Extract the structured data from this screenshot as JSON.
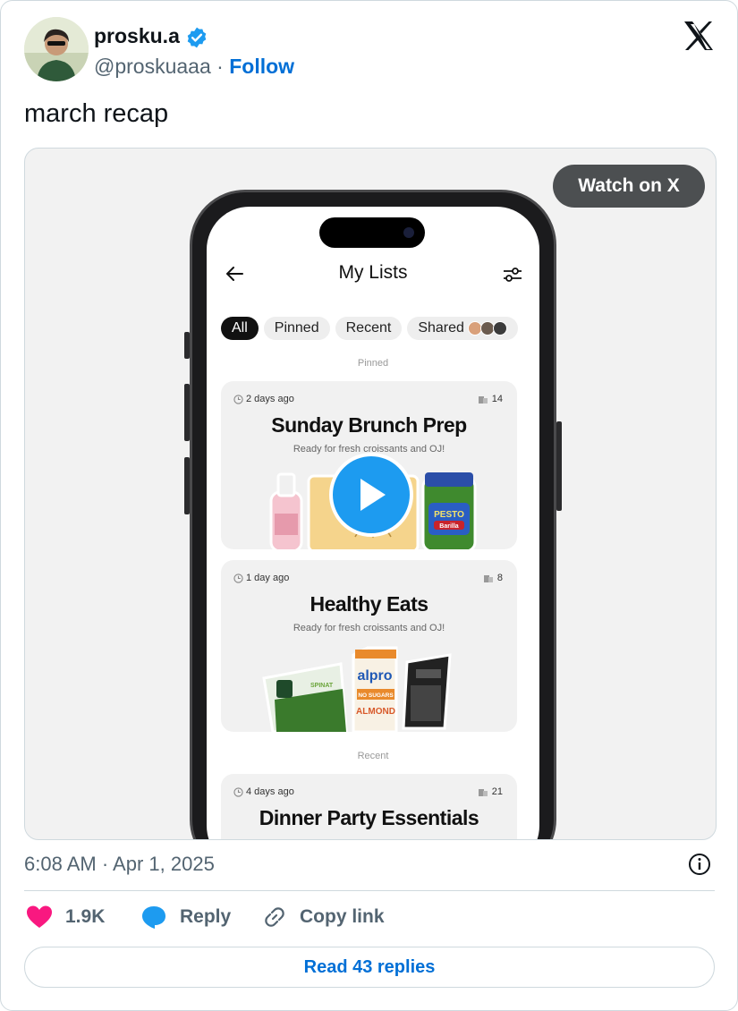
{
  "author": {
    "display_name": "prosku.a",
    "handle": "@proskuaaa",
    "separator": "·",
    "follow_label": "Follow"
  },
  "tweet": {
    "text": "march recap",
    "timestamp": "6:08 AM · Apr 1, 2025"
  },
  "media": {
    "watch_label": "Watch on X",
    "app": {
      "title": "My Lists",
      "chips": [
        "All",
        "Pinned",
        "Recent",
        "Shared"
      ],
      "pinned_label": "Pinned",
      "recent_label": "Recent",
      "cards": [
        {
          "time": "2 days ago",
          "count": "14",
          "title": "Sunday Brunch Prep",
          "subtitle": "Ready for fresh croissants and OJ!"
        },
        {
          "time": "1 day ago",
          "count": "8",
          "title": "Healthy Eats",
          "subtitle": "Ready for fresh croissants and OJ!"
        },
        {
          "time": "4 days ago",
          "count": "21",
          "title": "Dinner Party Essentials"
        }
      ],
      "product_labels": {
        "pesto": "PESTO",
        "barilla": "Barilla",
        "alpro": "alpro",
        "no_sugars": "NO SUGARS",
        "almond": "ALMOND",
        "spinat": "SPINAT"
      }
    }
  },
  "actions": {
    "likes": "1.9K",
    "reply_label": "Reply",
    "copy_label": "Copy link",
    "read_replies": "Read 43 replies"
  },
  "colors": {
    "accent": "#1d9bf0",
    "link": "#006fd6",
    "like": "#f91880",
    "muted": "#536471",
    "watch_button": "#4c4f51"
  },
  "icons": [
    "verified-badge-icon",
    "x-logo-icon",
    "play-icon",
    "info-icon",
    "heart-icon",
    "reply-bubble-icon",
    "link-icon",
    "back-arrow-icon",
    "filter-sliders-icon",
    "clock-icon",
    "items-icon"
  ]
}
